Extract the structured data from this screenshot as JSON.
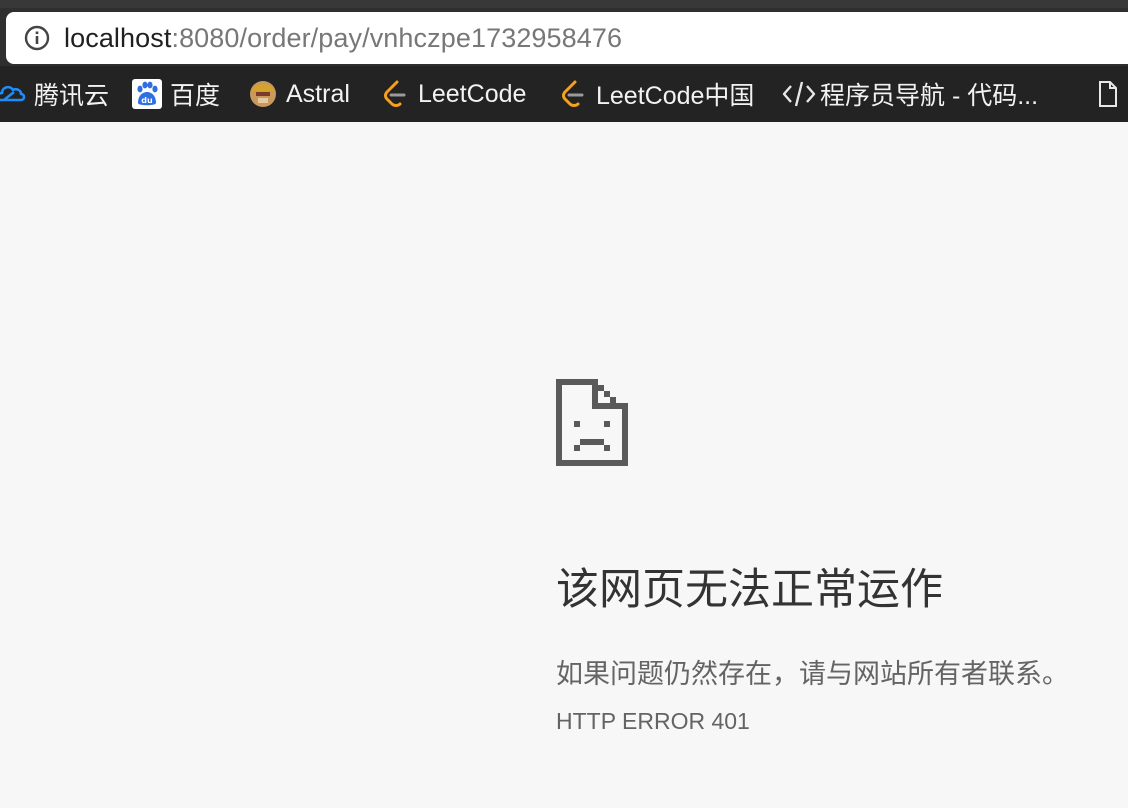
{
  "address_bar": {
    "host": "localhost",
    "path": ":8080/order/pay/vnhczpe1732958476",
    "security_icon": "info-circle-icon"
  },
  "bookmarks": [
    {
      "label": "腾讯云",
      "icon": "tencent-cloud-icon"
    },
    {
      "label": "百度",
      "icon": "baidu-icon"
    },
    {
      "label": "Astral",
      "icon": "astral-avatar-icon"
    },
    {
      "label": "LeetCode",
      "icon": "leetcode-icon"
    },
    {
      "label": "LeetCode中国",
      "icon": "leetcode-icon"
    },
    {
      "label": "程序员导航 - 代码...",
      "icon": "code-brackets-icon"
    },
    {
      "label": "",
      "icon": "document-icon"
    }
  ],
  "error": {
    "icon": "sad-page-icon",
    "title": "该网页无法正常运作",
    "description": "如果问题仍然存在，请与网站所有者联系。",
    "code": "HTTP ERROR 401"
  },
  "colors": {
    "page_background": "#f7f7f7",
    "bookmarks_bar": "#232323",
    "title_text": "#333333",
    "secondary_text": "#646464",
    "tencent_blue": "#1f8df7",
    "baidu_blue": "#2f6fe0",
    "leetcode_orange": "#f89f1b"
  }
}
